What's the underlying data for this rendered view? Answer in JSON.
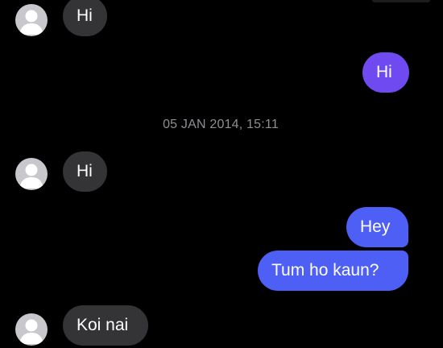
{
  "conversation": {
    "messages": [
      {
        "direction": "incoming",
        "text": "Hi"
      },
      {
        "direction": "outgoing",
        "text": "Hi"
      },
      {
        "direction": "incoming",
        "text": "Hi"
      },
      {
        "direction": "outgoing",
        "text": "Hey"
      },
      {
        "direction": "outgoing",
        "text": "Tum ho kaun?"
      },
      {
        "direction": "incoming",
        "text": "Koi nai"
      }
    ],
    "timestamp": "05 JAN 2014, 15:11"
  },
  "colors": {
    "background": "#000000",
    "incoming_bubble": "#343437",
    "outgoing_bubble_purple": "#6f4af0",
    "outgoing_bubble_blue": "#4e5ff5",
    "timestamp_text": "#8e8e93",
    "avatar": "#c7c7cc"
  },
  "icons": {
    "avatar": "default-user-silhouette-icon"
  }
}
